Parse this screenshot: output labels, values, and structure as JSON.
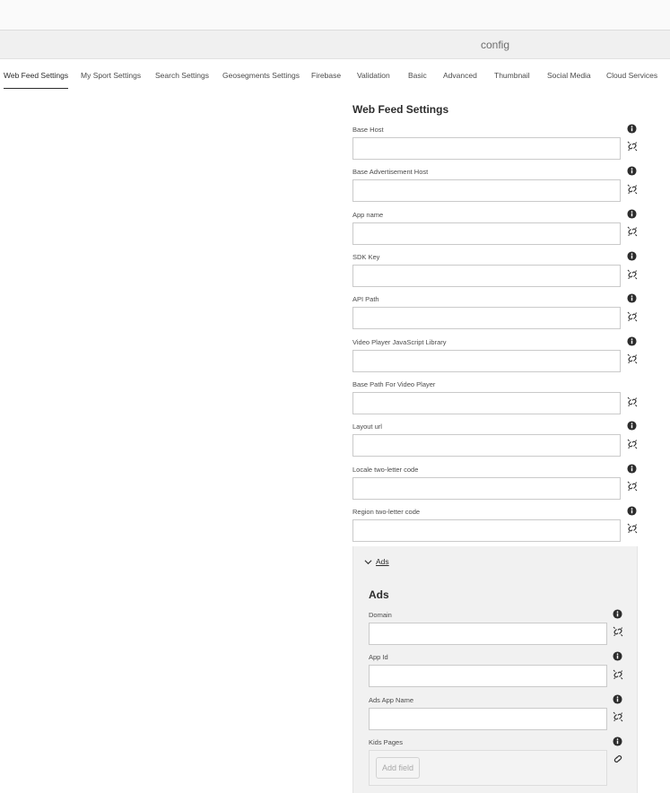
{
  "header": {
    "title": "config"
  },
  "tabs": [
    {
      "label": "Web Feed Settings",
      "active": true
    },
    {
      "label": "My Sport Settings"
    },
    {
      "label": "Search Settings"
    },
    {
      "label": "Geosegments Settings"
    },
    {
      "label": "Firebase"
    },
    {
      "label": "Validation"
    },
    {
      "label": "Basic"
    },
    {
      "label": "Advanced"
    },
    {
      "label": "Thumbnail"
    },
    {
      "label": "Social Media"
    },
    {
      "label": "Cloud Services"
    }
  ],
  "web_feed": {
    "title": "Web Feed Settings",
    "fields": [
      {
        "label": "Base Host",
        "value": ""
      },
      {
        "label": "Base Advertisement Host",
        "value": ""
      },
      {
        "label": "App name",
        "value": ""
      },
      {
        "label": "SDK Key",
        "value": ""
      },
      {
        "label": "API Path",
        "value": ""
      },
      {
        "label": "Video Player JavaScript Library",
        "value": ""
      },
      {
        "label": "Base Path For Video Player",
        "value": ""
      },
      {
        "label": "Layout url",
        "value": ""
      },
      {
        "label": "Locale two-letter code",
        "value": ""
      },
      {
        "label": "Region two-letter code",
        "value": ""
      }
    ]
  },
  "ads": {
    "toggle_label": "Ads",
    "title": "Ads",
    "fields": [
      {
        "label": "Domain",
        "value": ""
      },
      {
        "label": "App Id",
        "value": ""
      },
      {
        "label": "Ads App Name",
        "value": ""
      }
    ],
    "kids_pages": {
      "label": "Kids Pages",
      "add_label": "Add field"
    }
  },
  "icons": {
    "info": "info-icon",
    "link": "link-broken-icon",
    "link_active": "link-icon",
    "chevron": "chevron-down-icon"
  }
}
